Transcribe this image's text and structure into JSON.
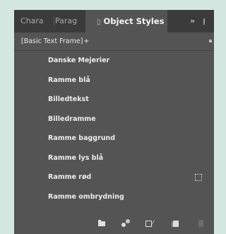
{
  "tabs": [
    {
      "label": "Chara",
      "active": false
    },
    {
      "label": "Parag",
      "active": false
    },
    {
      "label": "Object Styles",
      "active": true,
      "close_glyph": "▯"
    }
  ],
  "overflow_label": "»",
  "basic_style": {
    "label": "[Basic Text Frame]",
    "marker": "+"
  },
  "styles": [
    {
      "label": "Danske Mejerier",
      "override": false
    },
    {
      "label": "Ramme blå",
      "override": false
    },
    {
      "label": "Billedtekst",
      "override": false
    },
    {
      "label": "Billedramme",
      "override": false
    },
    {
      "label": "Ramme baggrund",
      "override": false
    },
    {
      "label": "Ramme lys blå",
      "override": false
    },
    {
      "label": "Ramme rød",
      "override": true
    },
    {
      "label": "Ramme ombrydning",
      "override": false
    }
  ],
  "bottom_icons": [
    "folder-icon",
    "style-sets-icon",
    "clear-overrides-icon",
    "new-style-icon",
    "trash-icon"
  ],
  "colors": {
    "background": "#d5e7e1",
    "panel": "#545454",
    "tabbar": "#3b3b3b"
  }
}
